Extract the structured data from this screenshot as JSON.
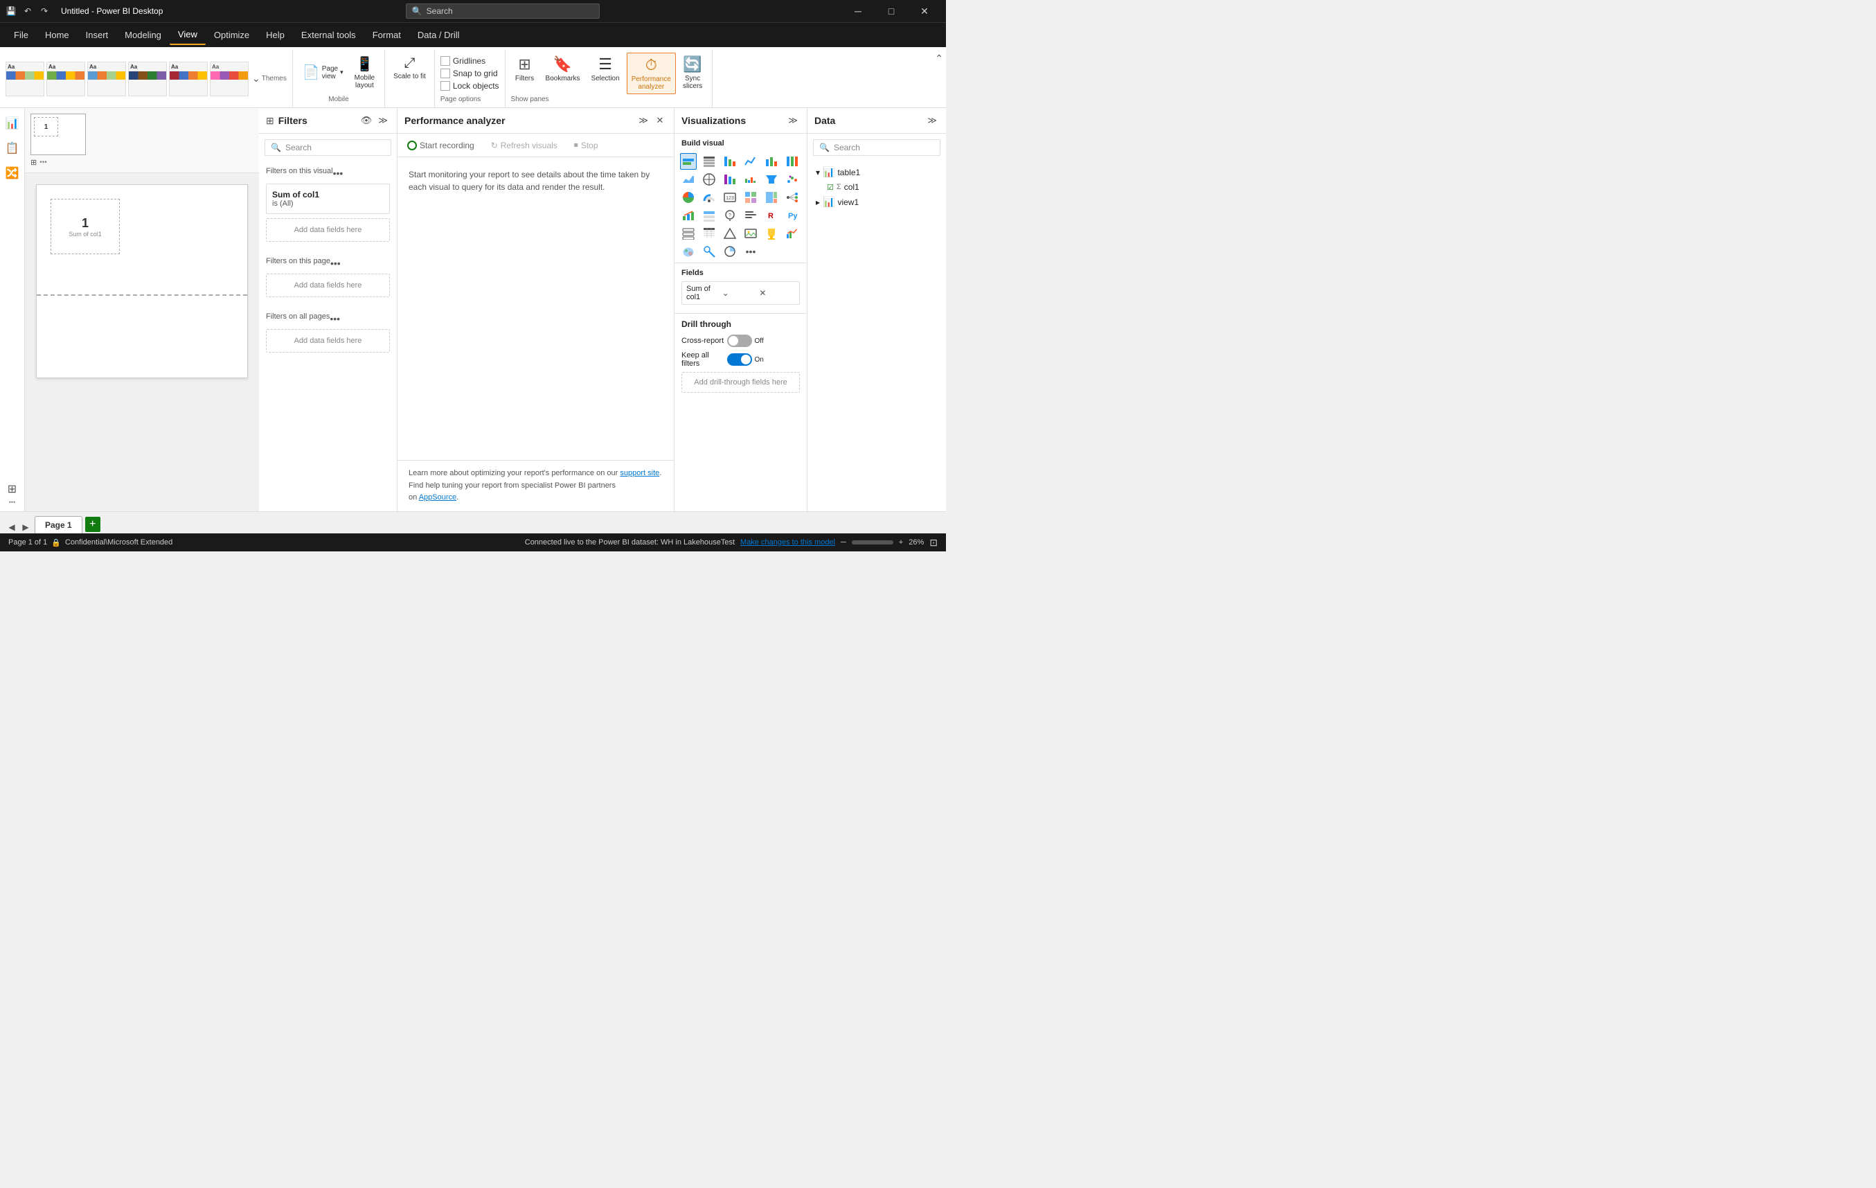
{
  "titleBar": {
    "title": "Untitled - Power BI Desktop",
    "search_placeholder": "Search",
    "save_icon": "💾",
    "undo_icon": "↶",
    "redo_icon": "↷",
    "minimize": "─",
    "maximize": "□",
    "close": "✕"
  },
  "menuBar": {
    "items": [
      "File",
      "Home",
      "Insert",
      "Modeling",
      "View",
      "Optimize",
      "Help",
      "External tools",
      "Format",
      "Data / Drill"
    ],
    "active": "View",
    "format_tab": "Format",
    "data_drill_tab": "Data / Drill"
  },
  "ribbon": {
    "themes_label": "Themes",
    "scale_to_fit": "Scale to fit",
    "page_view_label": "Page\nview",
    "mobile_layout_label": "Mobile\nlayout",
    "gridlines_label": "Gridlines",
    "snap_to_grid_label": "Snap to grid",
    "lock_objects_label": "Lock objects",
    "page_options_label": "Page options",
    "filters_btn": "Filters",
    "bookmarks_btn": "Bookmarks",
    "selection_btn": "Selection",
    "performance_btn": "Performance\nanalyzer",
    "sync_slicers_btn": "Sync\nslicers",
    "show_panes_label": "Show panes"
  },
  "filtersPanel": {
    "title": "Filters",
    "search_placeholder": "Search",
    "filters_on_this_visual": "Filters on this visual",
    "filter_field": "Sum of col1",
    "filter_value": "is (All)",
    "add_data_fields_1": "Add data fields here",
    "filters_on_this_page": "Filters on this page",
    "add_data_fields_2": "Add data fields here",
    "filters_on_all_pages": "Filters on all pages",
    "add_data_fields_3": "Add data fields here"
  },
  "perfPanel": {
    "title": "Performance analyzer",
    "start_recording": "Start recording",
    "refresh_visuals": "Refresh visuals",
    "stop": "Stop",
    "description": "Start monitoring your report to see details about the time taken by each visual to query for its data and render the result.",
    "footer_text": "Learn more about optimizing your report's performance on our ",
    "footer_link1": "support site",
    "footer_text2": ".\nFind help tuning your report from specialist Power BI partners\non ",
    "footer_link2": "AppSource",
    "footer_end": "."
  },
  "vizPanel": {
    "title": "Visualizations",
    "build_visual_label": "Build visual",
    "fields_label": "Fields",
    "field_value": "Sum of col1",
    "drill_through_label": "Drill through",
    "cross_report_label": "Cross-report",
    "cross_report_state": "Off",
    "keep_all_filters_label": "Keep all filters",
    "keep_all_filters_state": "On",
    "add_drill_through": "Add drill-through fields here",
    "viz_icons": [
      "📊",
      "📋",
      "📊",
      "📈",
      "📊",
      "📊",
      "📉",
      "⛰",
      "📊",
      "📊",
      "📊",
      "📊",
      "🗺",
      "📊",
      "🍩",
      "⭕",
      "📊",
      "📊",
      "📊",
      "⚙",
      "🔵",
      "📊",
      "📊",
      "📊",
      "🗺",
      "📊",
      "📊",
      "📊",
      "⭐",
      "🐍",
      "🔲",
      "📊",
      "📊",
      "📊",
      "🗡",
      "🔵",
      "📊",
      "📊",
      "📊",
      "📊",
      "🔗",
      "▶"
    ]
  },
  "dataPanel": {
    "title": "Data",
    "search_placeholder": "Search",
    "table1": "table1",
    "col1": "col1",
    "view1": "view1",
    "expand_icon": "▸",
    "collapse_icon": "▾"
  },
  "canvas": {
    "visual_value": "1",
    "visual_label": "Sum of col1"
  },
  "pageTabs": {
    "page1_label": "Page 1",
    "add_page_icon": "+",
    "page_info": "Page 1 of 1"
  },
  "statusBar": {
    "left": "Page 1 of 1",
    "lock_icon": "🔒",
    "classification": "Confidential\\Microsoft Extended",
    "connection": "Connected live to the Power BI dataset: WH in LakehouseTest",
    "make_changes": "Make changes to this model",
    "zoom_out": "─",
    "zoom_in": "+",
    "zoom_level": "26%"
  }
}
